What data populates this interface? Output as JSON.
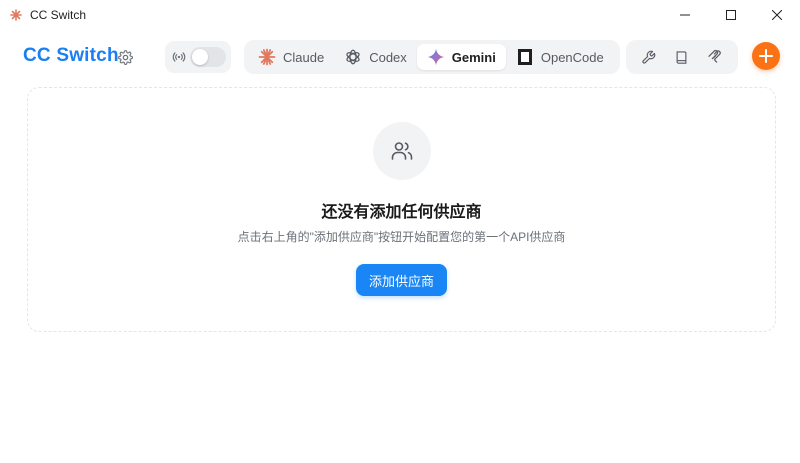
{
  "window": {
    "title": "CC Switch",
    "controls": [
      "minimize-icon",
      "maximize-icon",
      "close-icon"
    ]
  },
  "header": {
    "brand": "CC Switch",
    "proxy_toggle_on": false,
    "tabs": [
      {
        "label": "Claude",
        "icon": "claude-icon",
        "active": false
      },
      {
        "label": "Codex",
        "icon": "codex-icon",
        "active": false
      },
      {
        "label": "Gemini",
        "icon": "gemini-icon",
        "active": true
      },
      {
        "label": "OpenCode",
        "icon": "opencode-icon",
        "active": false
      }
    ],
    "tools": [
      "wrench-icon",
      "book-icon",
      "mcp-icon"
    ],
    "add_icon": "plus-icon"
  },
  "empty_state": {
    "icon": "users-icon",
    "title": "还没有添加任何供应商",
    "description": "点击右上角的\"添加供应商\"按钮开始配置您的第一个API供应商",
    "button_label": "添加供应商"
  },
  "colors": {
    "brand": "#1a7ff2",
    "primary_button": "#1a86f5",
    "add_fab": "#f97316",
    "claude": "#e07a5f"
  }
}
